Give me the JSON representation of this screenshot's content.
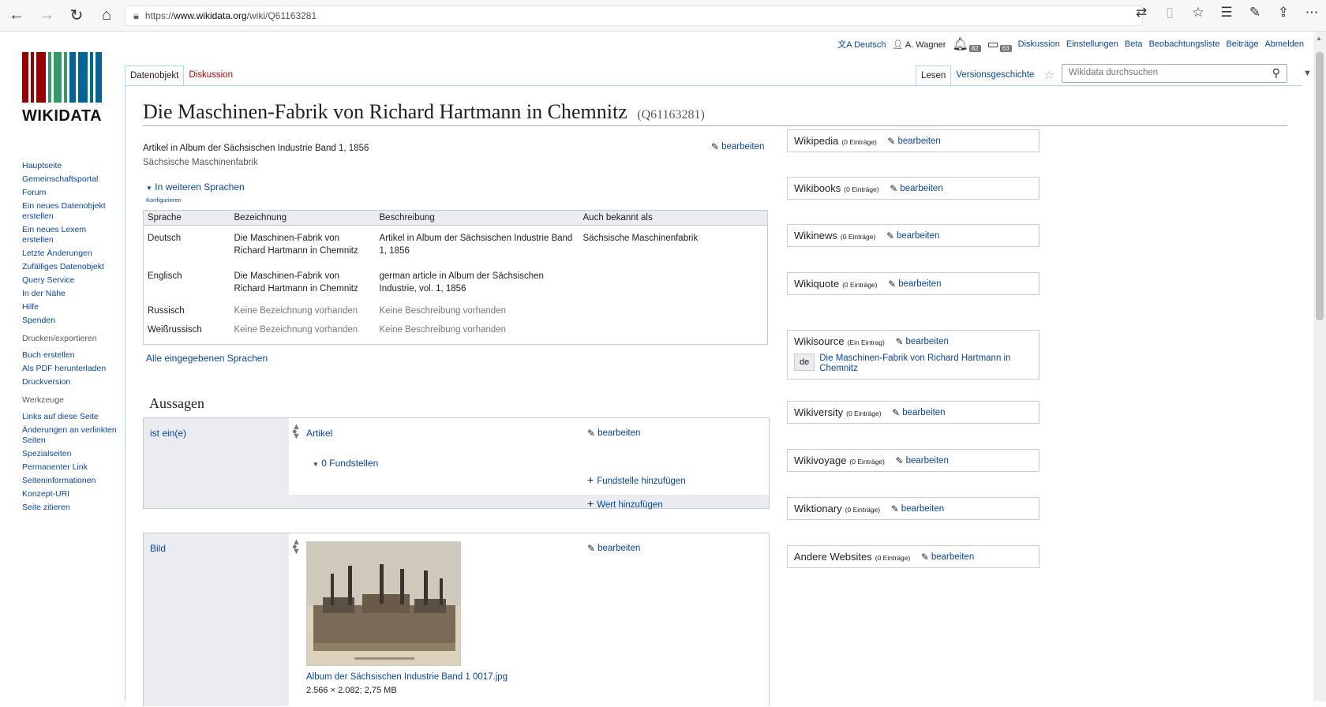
{
  "browser": {
    "url_prefix": "https://",
    "url_host": "www.wikidata.org",
    "url_path": "/wiki/Q61163281"
  },
  "personal": {
    "language": "Deutsch",
    "username": "A. Wagner",
    "notif_alerts": "82",
    "notif_notices": "63",
    "talk": "Diskussion",
    "preferences": "Einstellungen",
    "beta": "Beta",
    "watchlist": "Beobachtungsliste",
    "contributions": "Beiträge",
    "logout": "Abmelden"
  },
  "logo": {
    "wordmark": "WIKIDATA"
  },
  "sidebar": {
    "nav": [
      "Hauptseite",
      "Gemeinschaftsportal",
      "Forum",
      "Ein neues Datenobjekt erstellen",
      "Ein neues Lexem erstellen",
      "Letzte Änderungen",
      "Zufälliges Datenobjekt",
      "Query Service",
      "In der Nähe",
      "Hilfe",
      "Spenden"
    ],
    "print_heading": "Drucken/exportieren",
    "print": [
      "Buch erstellen",
      "Als PDF herunterladen",
      "Druckversion"
    ],
    "tools_heading": "Werkzeuge",
    "tools": [
      "Links auf diese Seite",
      "Änderungen an verlinkten Seiten",
      "Spezialseiten",
      "Permanenter Link",
      "Seiteninformationen",
      "Konzept-URI",
      "Seite zitieren"
    ]
  },
  "tabs": {
    "item": "Datenobjekt",
    "discussion": "Diskussion",
    "read": "Lesen",
    "history": "Versionsgeschichte"
  },
  "search": {
    "placeholder": "Wikidata durchsuchen"
  },
  "item": {
    "title": "Die Maschinen-Fabrik von Richard Hartmann in Chemnitz",
    "qid": "(Q61163281)",
    "description": "Artikel in Album der Sächsischen Industrie Band 1, 1856",
    "alias": "Sächsische Maschinenfabrik",
    "edit": "bearbeiten"
  },
  "languages": {
    "toggle": "In weiteren Sprachen",
    "configure": "Konfigurieren",
    "headers": [
      "Sprache",
      "Bezeichnung",
      "Beschreibung",
      "Auch bekannt als"
    ],
    "rows": [
      {
        "lang": "Deutsch",
        "label": "Die Maschinen-Fabrik von Richard Hartmann in Chemnitz",
        "desc": "Artikel in Album der Sächsischen Industrie Band 1, 1856",
        "aka": "Sächsische Maschinenfabrik"
      },
      {
        "lang": "Englisch",
        "label": "Die Maschinen-Fabrik von Richard Hartmann in Chemnitz",
        "desc": "german article in Album der Sächsischen Industrie, vol. 1, 1856",
        "aka": ""
      },
      {
        "lang": "Russisch",
        "label": "Keine Bezeichnung vorhanden",
        "desc": "Keine Beschreibung vorhanden",
        "aka": ""
      },
      {
        "lang": "Weißrussisch",
        "label": "Keine Bezeichnung vorhanden",
        "desc": "Keine Beschreibung vorhanden",
        "aka": ""
      }
    ],
    "all": "Alle eingegebenen Sprachen"
  },
  "statements": {
    "heading": "Aussagen",
    "instance_of": {
      "property": "ist ein(e)",
      "value": "Artikel",
      "references": "0 Fundstellen",
      "add_reference": "Fundstelle hinzufügen",
      "add_value": "Wert hinzufügen"
    },
    "image": {
      "property": "Bild",
      "file": "Album der Sächsischen Industrie Band 1 0017.jpg",
      "dims": "2.566 × 2.082; 2,75 MB"
    }
  },
  "sitelinks": [
    {
      "name": "Wikipedia",
      "count": "(0 Einträge)"
    },
    {
      "name": "Wikibooks",
      "count": "(0 Einträge)"
    },
    {
      "name": "Wikinews",
      "count": "(0 Einträge)"
    },
    {
      "name": "Wikiquote",
      "count": "(0 Einträge)"
    },
    {
      "name": "Wikisource",
      "count": "(Ein Eintrag)",
      "entry_code": "de",
      "entry_title": "Die Maschinen-Fabrik von Richard Hartmann in Chemnitz"
    },
    {
      "name": "Wikiversity",
      "count": "(0 Einträge)"
    },
    {
      "name": "Wikivoyage",
      "count": "(0 Einträge)"
    },
    {
      "name": "Wiktionary",
      "count": "(0 Einträge)"
    },
    {
      "name": "Andere Websites",
      "count": "(0 Einträge)"
    }
  ],
  "colors": {
    "link": "#0645ad",
    "talk_tab": "#ba0000",
    "logo_red": "#990000",
    "logo_green": "#339966",
    "logo_blue": "#006699"
  }
}
